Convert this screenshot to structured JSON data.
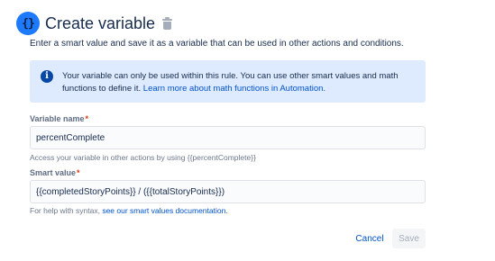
{
  "header": {
    "icon_glyph": "{}",
    "icon_name": "variable-icon",
    "title": "Create variable",
    "delete_icon_name": "trash-icon"
  },
  "description": "Enter a smart value and save it as a variable that can be used in other actions and conditions.",
  "info_banner": {
    "icon_glyph": "i",
    "text": "Your variable can only be used within this rule. You can use other smart values and math functions to define it. ",
    "link_text": "Learn more about math functions in Automation."
  },
  "variable_name": {
    "label": "Variable name",
    "required_mark": "*",
    "value": "percentComplete",
    "help": "Access your variable in other actions by using {{percentComplete}}"
  },
  "smart_value": {
    "label": "Smart value",
    "required_mark": "*",
    "value": "{{completedStoryPoints}} / ({{totalStoryPoints}})",
    "help_prefix": "For help with syntax, ",
    "help_link": "see our smart values documentation."
  },
  "actions": {
    "cancel": "Cancel",
    "save": "Save"
  },
  "colors": {
    "accent": "#0052cc",
    "info_bg": "#deebff",
    "required": "#de350b"
  }
}
